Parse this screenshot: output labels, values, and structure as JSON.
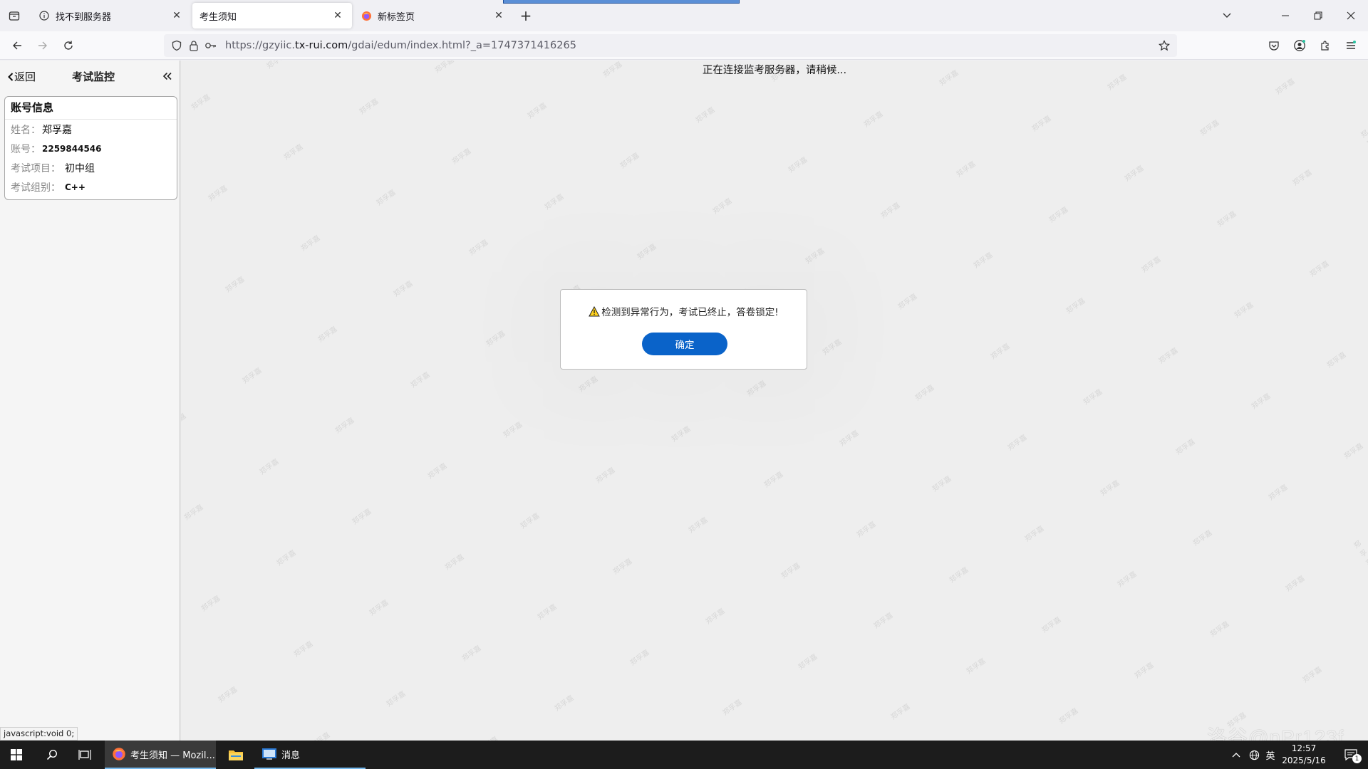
{
  "browser": {
    "tabs": [
      {
        "title": "找不到服务器",
        "icon": "info-icon"
      },
      {
        "title": "考生须知",
        "icon": "none",
        "active": true
      },
      {
        "title": "新标签页",
        "icon": "firefox-icon"
      }
    ],
    "url_prefix": "https://gzyiic.",
    "url_domain": "tx-rui.com",
    "url_path": "/gdai/edum/index.html?_a=1747371416265"
  },
  "sidebar": {
    "back_label": "返回",
    "title": "考试监控",
    "card_title": "账号信息",
    "fields": [
      {
        "key": "姓名：",
        "value": "郑孚嘉"
      },
      {
        "key": "账号：",
        "value": "2259844546"
      },
      {
        "key": "考试项目：",
        "value": "初中组"
      },
      {
        "key": "考试组别：",
        "value": "C++"
      }
    ]
  },
  "main": {
    "status_text": "正在连接监考服务器，请稍候...",
    "watermark_text": "郑孚嘉"
  },
  "dialog": {
    "message": "检测到异常行为，考试已终止，答卷锁定!",
    "ok_label": "确定",
    "accent_color": "#0a63c9"
  },
  "statusbar": {
    "link_text": "javascript:void 0;"
  },
  "corner_watermark": "洛谷@nPr123f",
  "taskbar": {
    "apps": [
      {
        "label": "考生须知 — Mozil...",
        "icon": "firefox-icon"
      },
      {
        "label": "",
        "icon": "file-explorer-icon"
      },
      {
        "label": "消息",
        "icon": "messages-icon"
      }
    ],
    "ime": "英",
    "time": "12:57",
    "date": "2025/5/16",
    "notification_count": "1"
  }
}
